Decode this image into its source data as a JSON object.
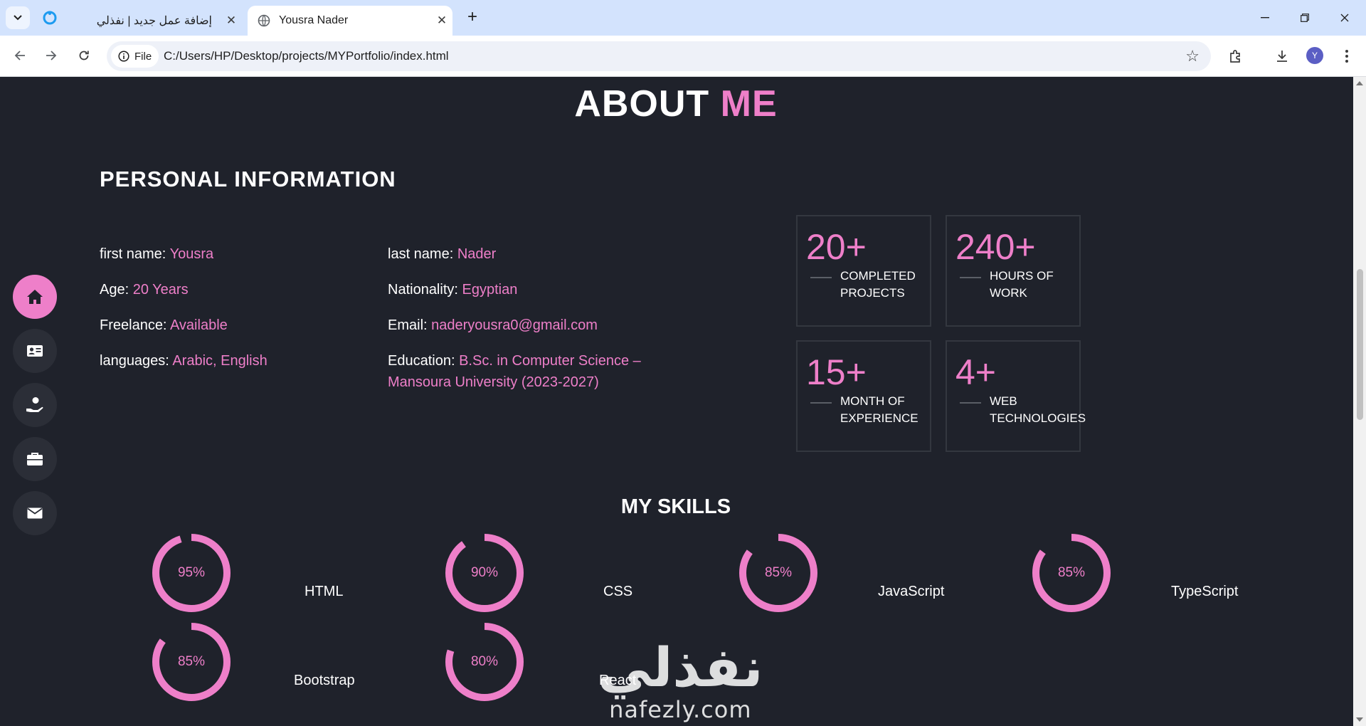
{
  "browser": {
    "tabs": [
      {
        "title": "إضافة عمل جديد | نفذلي",
        "active": false
      },
      {
        "title": "Yousra Nader",
        "active": true
      }
    ],
    "url_chip": "File",
    "url": "C:/Users/HP/Desktop/projects/MYPortfolio/index.html",
    "profile_initial": "Y"
  },
  "about": {
    "title_main": "ABOUT",
    "title_accent": "ME",
    "personal_heading": "PERSONAL INFORMATION",
    "left_col": [
      {
        "label": "first name:",
        "value": "Yousra"
      },
      {
        "label": "Age:",
        "value": "20 Years"
      },
      {
        "label": "Freelance:",
        "value": "Available"
      },
      {
        "label": "languages:",
        "value": "Arabic, English"
      }
    ],
    "right_col": [
      {
        "label": "last name:",
        "value": "Nader"
      },
      {
        "label": "Nationality:",
        "value": "Egyptian"
      },
      {
        "label": "Email:",
        "value": "naderyousra0@gmail.com"
      },
      {
        "label": "Education:",
        "value": "B.Sc. in Computer Science – Mansoura University (2023-2027)"
      }
    ],
    "stats": [
      {
        "number": "20+",
        "label_line1": "COMPLETED",
        "label_line2": "PROJECTS"
      },
      {
        "number": "240+",
        "label_line1": "HOURS OF",
        "label_line2": "WORK"
      },
      {
        "number": "15+",
        "label_line1": "MONTH OF",
        "label_line2": "EXPERIENCE"
      },
      {
        "number": "4+",
        "label_line1": "WEB",
        "label_line2": "TECHNOLOGIES"
      }
    ]
  },
  "skills": {
    "heading": "MY SKILLS",
    "items": [
      {
        "name": "HTML",
        "percent_label": "95%",
        "percent": 95
      },
      {
        "name": "CSS",
        "percent_label": "90%",
        "percent": 90
      },
      {
        "name": "JavaScript",
        "percent_label": "85%",
        "percent": 85
      },
      {
        "name": "TypeScript",
        "percent_label": "85%",
        "percent": 85
      },
      {
        "name": "Bootstrap",
        "percent_label": "85%",
        "percent": 85
      },
      {
        "name": "React",
        "percent_label": "80%",
        "percent": 80
      }
    ]
  },
  "sidebar": {
    "items": [
      {
        "icon": "home-icon",
        "active": true
      },
      {
        "icon": "id-card-icon",
        "active": false
      },
      {
        "icon": "hand-user-icon",
        "active": false
      },
      {
        "icon": "briefcase-icon",
        "active": false
      },
      {
        "icon": "envelope-icon",
        "active": false
      }
    ]
  },
  "watermark": {
    "arabic": "نفذلي",
    "latin": "nafezly.com"
  },
  "colors": {
    "accent": "#ee7fc9",
    "background": "#1f222b",
    "chrome": "#d3e3fd"
  }
}
